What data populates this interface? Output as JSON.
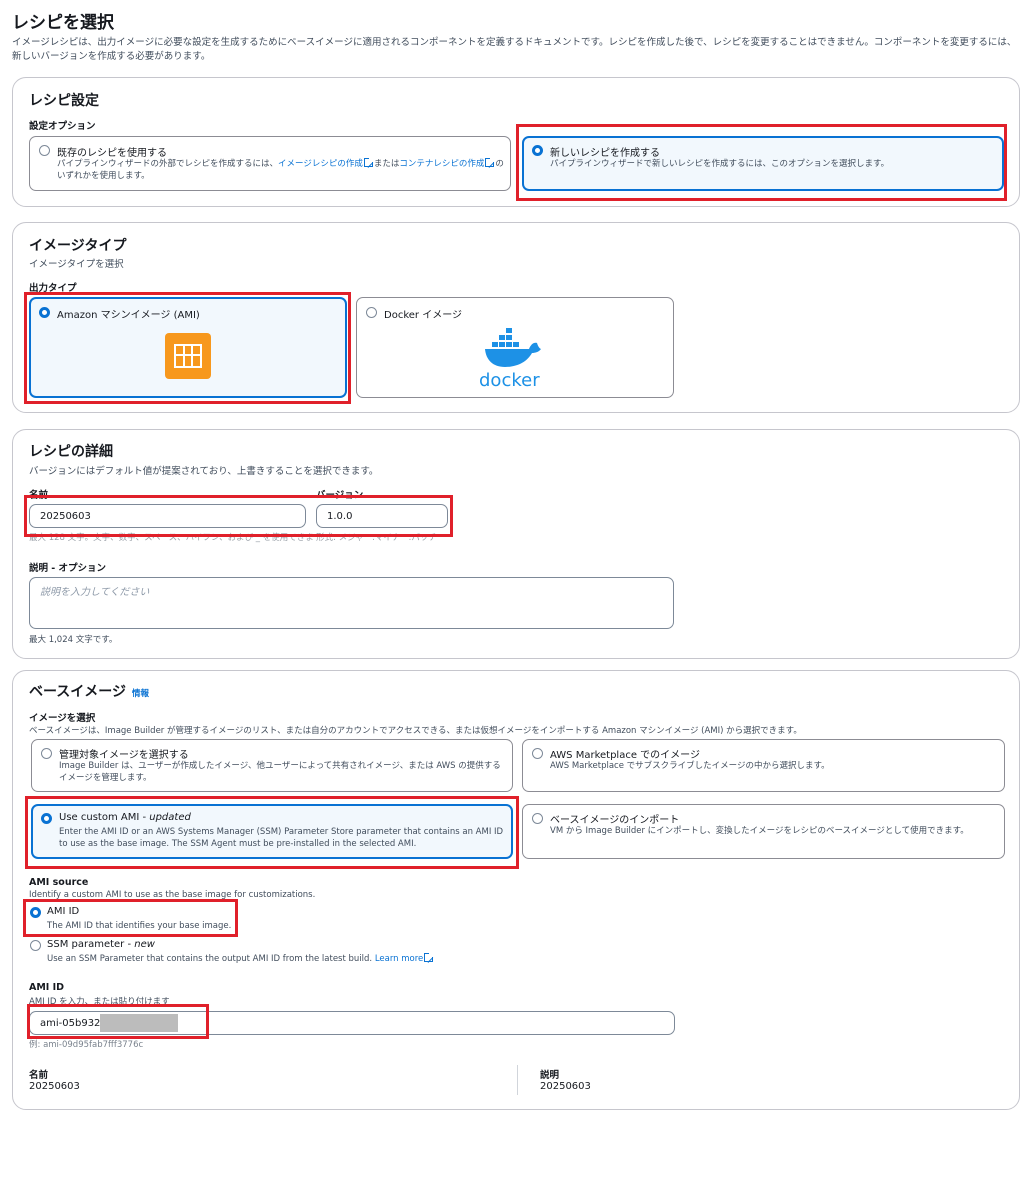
{
  "page": {
    "title": "レシピを選択",
    "description": "イメージレシピは、出力イメージに必要な設定を生成するためにベースイメージに適用されるコンポーネントを定義するドキュメントです。レシピを作成した後で、レシピを変更することはできません。コンポーネントを変更するには、新しいバージョンを作成する必要があります。"
  },
  "recipe_settings": {
    "title": "レシピ設定",
    "option_label": "設定オプション",
    "options": [
      {
        "title": "既存のレシピを使用する",
        "desc_prefix": "パイプラインウィザードの外部でレシピを作成するには、",
        "link1": "イメージレシピの作成",
        "desc_mid": "または",
        "link2": "コンテナレシピの作成",
        "desc_suffix": "のいずれかを使用します。",
        "selected": false
      },
      {
        "title": "新しいレシピを作成する",
        "desc": "パイプラインウィザードで新しいレシピを作成するには、このオプションを選択します。",
        "selected": true
      }
    ]
  },
  "image_type": {
    "title": "イメージタイプ",
    "desc": "イメージタイプを選択",
    "output_label": "出力タイプ",
    "options": [
      {
        "title": "Amazon マシンイメージ (AMI)",
        "icon": "ami-icon",
        "selected": true
      },
      {
        "title": "Docker イメージ",
        "icon": "docker-logo",
        "logo_text": "docker",
        "selected": false
      }
    ]
  },
  "recipe_details": {
    "title": "レシピの詳細",
    "desc": "バージョンにはデフォルト値が提案されており、上書きすることを選択できます。",
    "name_label": "名前",
    "name_value": "20250603",
    "version_label": "バージョン",
    "version_value": "1.0.0",
    "name_hint": "最大 128 文字。文字、数字、スペース、ハイフン、および _ を使用できます。",
    "version_hint": "形式: メジャー.マイナー.パッチ",
    "description_label": "説明 - オプション",
    "description_placeholder": "説明を入力してください",
    "description_hint": "最大 1,024 文字です。"
  },
  "base_image": {
    "title": "ベースイメージ",
    "info_link": "情報",
    "select_label": "イメージを選択",
    "select_desc": "ベースイメージは、Image Builder が管理するイメージのリスト、または自分のアカウントでアクセスできる、または仮想イメージをインポートする Amazon マシンイメージ (AMI) から選択できます。",
    "options": [
      {
        "title": "管理対象イメージを選択する",
        "desc": "Image Builder は、ユーザーが作成したイメージ、他ユーザーによって共有されイメージ、または AWS の提供するイメージを管理します。",
        "selected": false
      },
      {
        "title": "AWS Marketplace でのイメージ",
        "desc": "AWS Marketplace でサブスクライブしたイメージの中から選択します。",
        "selected": false
      },
      {
        "title": "Use custom AMI - ",
        "title_em": "updated",
        "desc": "Enter the AMI ID or an AWS Systems Manager (SSM) Parameter Store parameter that contains an AMI ID to use as the base image. The SSM Agent must be pre-installed in the selected AMI.",
        "selected": true
      },
      {
        "title": "ベースイメージのインポート",
        "desc": "VM から Image Builder にインポートし、変換したイメージをレシピのベースイメージとして使用できます。",
        "selected": false
      }
    ],
    "ami_source": {
      "label": "AMI source",
      "desc": "Identify a custom AMI to use as the base image for customizations.",
      "options": [
        {
          "title": "AMI ID",
          "desc": "The AMI ID that identifies your base image.",
          "selected": true
        },
        {
          "title": "SSM parameter - ",
          "title_em": "new",
          "desc": "Use an SSM Parameter that contains the output AMI ID from the latest build.",
          "link": "Learn more",
          "selected": false
        }
      ]
    },
    "ami_id": {
      "label": "AMI ID",
      "desc": "AMI ID を入力、または貼り付けます",
      "value": "ami-05b9323",
      "example": "例: ami-09d95fab7fff3776c"
    },
    "summary": {
      "name_label": "名前",
      "name_value": "20250603",
      "desc_label": "説明",
      "desc_value": "20250603"
    }
  },
  "colors": {
    "accent": "#0972d3",
    "highlight": "#e0202a",
    "ami_orange": "#f7981d",
    "docker_blue": "#1d91e6"
  }
}
